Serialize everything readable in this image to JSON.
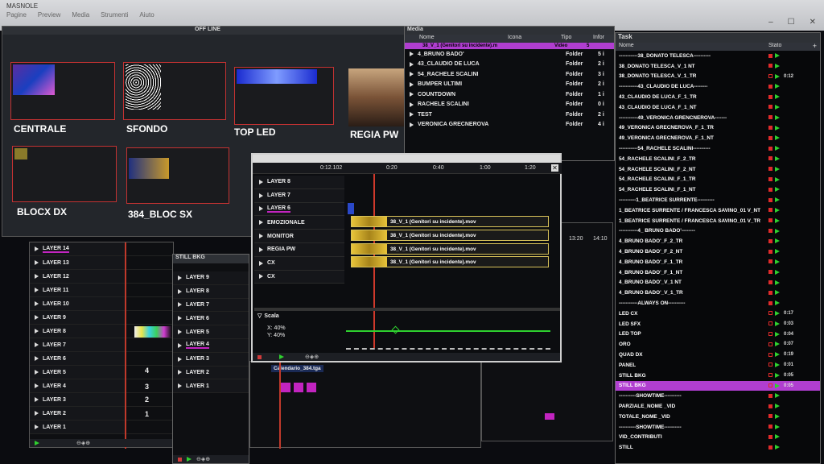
{
  "window": {
    "title": "MASNOLE",
    "menu": [
      "Pagine",
      "Preview",
      "Media",
      "Strumenti",
      "Aiuto"
    ],
    "controls": [
      "–",
      "☐",
      "✕"
    ]
  },
  "offline": {
    "title": "OFF LINE",
    "slots": [
      {
        "label": "CENTRALE"
      },
      {
        "label": "SFONDO"
      },
      {
        "label": "TOP LED"
      },
      {
        "label": "REGIA PW"
      },
      {
        "label": "BLOCX DX"
      },
      {
        "label": "384_BLOC SX"
      }
    ]
  },
  "media": {
    "title": "Media",
    "columns": [
      "Nome",
      "Icona",
      "Tipo",
      "Infor"
    ],
    "header_row": {
      "name": "38_V_1 (Genitori su incidente).m",
      "type": "Video",
      "info": "5"
    },
    "rows": [
      {
        "name": "4_BRUNO BADO'",
        "type": "Folder",
        "info": "5 i"
      },
      {
        "name": "43_CLAUDIO DE LUCA",
        "type": "Folder",
        "info": "2 i"
      },
      {
        "name": "54_RACHELE SCALINI",
        "type": "Folder",
        "info": "3 i"
      },
      {
        "name": "BUMPER ULTIMI",
        "type": "Folder",
        "info": "2 i"
      },
      {
        "name": "COUNTDOWN",
        "type": "Folder",
        "info": "1 i"
      },
      {
        "name": "RACHELE SCALINI",
        "type": "Folder",
        "info": "0 i"
      },
      {
        "name": "TEST",
        "type": "Folder",
        "info": "2 i"
      },
      {
        "name": "VERONICA GRECNEROVA",
        "type": "Folder",
        "info": "4 i"
      }
    ]
  },
  "task": {
    "title": "Task",
    "columns": [
      "Nome",
      "Stato"
    ],
    "add_label": "+",
    "rows": [
      {
        "name": "-----------38_DONATO TELESCA----------",
        "time": ""
      },
      {
        "name": "38_DONATO TELESCA_V_1 NT",
        "time": ""
      },
      {
        "name": "38_DONATO TELESCA_V_1_TR",
        "time": "0:12"
      },
      {
        "name": "-----------43_CLAUDIO DE LUCA--------",
        "time": ""
      },
      {
        "name": "43_CLAUDIO DE LUCA_F_1_TR",
        "time": ""
      },
      {
        "name": "43_CLAUDIO DE LUCA_F_1_NT",
        "time": ""
      },
      {
        "name": "-----------49_VERONICA GRENCNEROVA-------",
        "time": ""
      },
      {
        "name": "49_VERONICA GRECNEROVA_F_1_TR",
        "time": ""
      },
      {
        "name": "49_VERONICA GRECNEROVA_F_1_NT",
        "time": ""
      },
      {
        "name": "-----------54_RACHELE SCALINI----------",
        "time": ""
      },
      {
        "name": "54_RACHELE SCALINI_F_2_TR",
        "time": ""
      },
      {
        "name": "54_RACHELE SCALINI_F_2_NT",
        "time": ""
      },
      {
        "name": "54_RACHELE SCALINI_F_1_TR",
        "time": ""
      },
      {
        "name": "54_RACHELE SCALINI_F_1_NT",
        "time": ""
      },
      {
        "name": "----------1_BEATRICE SURRENTE----------",
        "time": ""
      },
      {
        "name": "1_BEATRICE SURRENTE / FRANCESCA SAVINO_01 V_NT",
        "time": ""
      },
      {
        "name": "1_BEATRICE SURRENTE / FRANCESCA SAVINO_01 V_TR",
        "time": ""
      },
      {
        "name": "-----------4_ BRUNO BADO'--------",
        "time": ""
      },
      {
        "name": "4_BRUNO BADO'_F_2_TR",
        "time": ""
      },
      {
        "name": "4_BRUNO BADO'_F_2_NT",
        "time": ""
      },
      {
        "name": "4_BRUNO BADO'_F_1_TR",
        "time": ""
      },
      {
        "name": "4_BRUNO BADO'_F_1_NT",
        "time": ""
      },
      {
        "name": "4_BRUNO BADO'_V_1 NT",
        "time": ""
      },
      {
        "name": "4_BRUNO BADO'_V_1_TR",
        "time": ""
      },
      {
        "name": "-----------ALWAYS ON----------",
        "time": ""
      },
      {
        "name": "LED CX",
        "time": "0:17"
      },
      {
        "name": "LED SFX",
        "time": "0:03"
      },
      {
        "name": "LED TOP",
        "time": "0:04"
      },
      {
        "name": "ORO",
        "time": "0:07"
      },
      {
        "name": "QUAD DX",
        "time": "0:19"
      },
      {
        "name": "PANEL",
        "time": "0:01"
      },
      {
        "name": "STILL BKG",
        "time": "0:05"
      },
      {
        "name": "STILL BKG",
        "time": "0:05"
      },
      {
        "name": "----------SHOWTIME----------",
        "time": ""
      },
      {
        "name": "PARZIALE_NOME _VID",
        "time": ""
      },
      {
        "name": "TOTALE_NOME _VID",
        "time": ""
      },
      {
        "name": "----------SHOWTIME----------",
        "time": ""
      },
      {
        "name": "VID_CONTRIBUTI",
        "time": ""
      },
      {
        "name": "STILL",
        "time": ""
      }
    ]
  },
  "layers_panel": {
    "rows": [
      "LAYER 14",
      "LAYER 13",
      "LAYER 12",
      "LAYER 11",
      "LAYER 10",
      "LAYER 9",
      "LAYER 8",
      "LAYER 7",
      "LAYER 6",
      "LAYER 5",
      "LAYER 4",
      "LAYER 3",
      "LAYER 2",
      "LAYER 1"
    ],
    "numbers": [
      "4",
      "3",
      "2",
      "1"
    ]
  },
  "still_panel": {
    "title": "STILL BKG",
    "rows": [
      "LAYER 9",
      "LAYER 8",
      "LAYER 7",
      "LAYER 6",
      "LAYER 5",
      "LAYER 4",
      "LAYER 3",
      "LAYER 2",
      "LAYER 1"
    ],
    "items": [
      "Calendario_384.tga",
      "Calendario_384.tga"
    ]
  },
  "timeline": {
    "time": "0:12.102",
    "ruler": [
      "0:20",
      "0:40",
      "1:00",
      "1:20"
    ],
    "layers": [
      "LAYER 8",
      "LAYER 7",
      "LAYER 6",
      "EMOZIONALE",
      "MONITOR",
      "REGIA PW",
      "CX",
      "CX"
    ],
    "clips": [
      "38_V_1 (Genitori su incidente).mov",
      "38_V_1 (Genitori su incidente).mov",
      "38_V_1 (Genitori su incidente).mov",
      "38_V_1 (Genitori su incidente).mov"
    ],
    "scale": {
      "label": "Scala",
      "x": "X: 40%",
      "y": "Y: 40%"
    }
  },
  "right_ruler": [
    "13:20",
    "14:10"
  ]
}
